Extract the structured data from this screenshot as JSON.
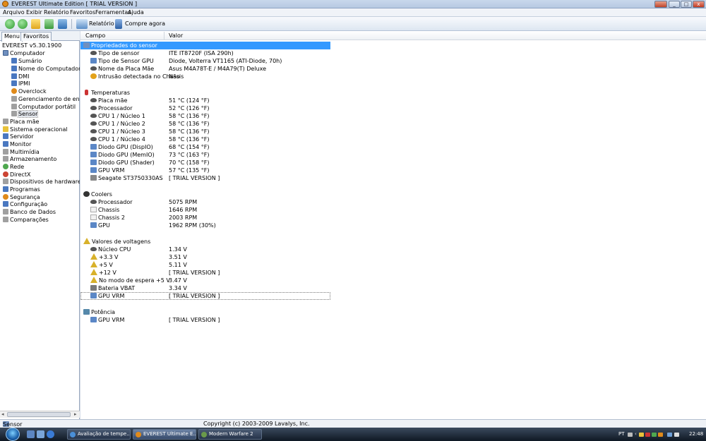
{
  "window": {
    "title": "EVEREST Ultimate Edition  [ TRIAL VERSION ]",
    "controls": [
      "_",
      "□",
      "x"
    ]
  },
  "menubar": [
    "Arquivo",
    "Exibir",
    "Relatório",
    "Favoritos",
    "Ferramentas",
    "Ajuda"
  ],
  "toolbar": {
    "report_label": "Relatório",
    "buy_label": "Compre agora"
  },
  "leftpanel": {
    "tabs": [
      "Menu",
      "Favoritos"
    ],
    "version": "EVEREST v5.30.1900",
    "tree": [
      {
        "label": "Computador",
        "icon": "computer-icon"
      },
      {
        "label": "Sumário",
        "icon": "summary-icon"
      },
      {
        "label": "Nome do Computador",
        "icon": "computer-name-icon"
      },
      {
        "label": "DMI",
        "icon": "dmi-icon"
      },
      {
        "label": "IPMI",
        "icon": "ipmi-icon"
      },
      {
        "label": "Overclock",
        "icon": "overclock-icon"
      },
      {
        "label": "Gerenciamento de energia",
        "icon": "power-management-icon"
      },
      {
        "label": "Computador portátil",
        "icon": "laptop-icon"
      },
      {
        "label": "Sensor",
        "icon": "sensor-icon"
      },
      {
        "label": "Placa mãe",
        "icon": "motherboard-icon"
      },
      {
        "label": "Sistema operacional",
        "icon": "os-icon"
      },
      {
        "label": "Servidor",
        "icon": "server-icon"
      },
      {
        "label": "Monitor",
        "icon": "monitor-icon"
      },
      {
        "label": "Multimídia",
        "icon": "multimedia-icon"
      },
      {
        "label": "Armazenamento",
        "icon": "storage-icon"
      },
      {
        "label": "Rede",
        "icon": "network-icon"
      },
      {
        "label": "DirectX",
        "icon": "directx-icon"
      },
      {
        "label": "Dispositivos de hardware",
        "icon": "hardware-devices-icon"
      },
      {
        "label": "Programas",
        "icon": "programs-icon"
      },
      {
        "label": "Segurança",
        "icon": "security-icon"
      },
      {
        "label": "Configuração",
        "icon": "configuration-icon"
      },
      {
        "label": "Banco de Dados",
        "icon": "database-icon"
      },
      {
        "label": "Comparações",
        "icon": "benchmark-icon"
      }
    ]
  },
  "columns": {
    "field": "Campo",
    "value": "Valor"
  },
  "sections": {
    "sensor_properties": {
      "title": "Propriedades do sensor",
      "rows": [
        {
          "field": "Tipo de sensor",
          "value": "ITE IT8720F  (ISA 290h)"
        },
        {
          "field": "Tipo de Sensor GPU",
          "value": "Diode, Volterra VT1165  (ATI-Diode, 70h)"
        },
        {
          "field": "Nome da Placa Mãe",
          "value": "Asus M4A78T-E / M4A79(T) Deluxe"
        },
        {
          "field": "Intrusão detectada no Chassis",
          "value": "Não"
        }
      ]
    },
    "temperatures": {
      "title": "Temperaturas",
      "rows": [
        {
          "field": "Placa mãe",
          "value": "51 °C  (124 °F)"
        },
        {
          "field": "Processador",
          "value": "52 °C  (126 °F)"
        },
        {
          "field": "CPU 1 / Núcleo 1",
          "value": "58 °C  (136 °F)"
        },
        {
          "field": "CPU 1 / Núcleo 2",
          "value": "58 °C  (136 °F)"
        },
        {
          "field": "CPU 1 / Núcleo 3",
          "value": "58 °C  (136 °F)"
        },
        {
          "field": "CPU 1 / Núcleo 4",
          "value": "58 °C  (136 °F)"
        },
        {
          "field": "Diodo GPU (DispIO)",
          "value": "68 °C  (154 °F)"
        },
        {
          "field": "Diodo GPU (MemIO)",
          "value": "73 °C  (163 °F)"
        },
        {
          "field": "Diodo GPU (Shader)",
          "value": "70 °C  (158 °F)"
        },
        {
          "field": "GPU VRM",
          "value": "57 °C  (135 °F)"
        },
        {
          "field": "Seagate ST3750330AS",
          "value": "[ TRIAL VERSION ]"
        }
      ]
    },
    "coolers": {
      "title": "Coolers",
      "rows": [
        {
          "field": "Processador",
          "value": "5075 RPM"
        },
        {
          "field": "Chassis",
          "value": "1646 RPM"
        },
        {
          "field": "Chassis 2",
          "value": "2003 RPM"
        },
        {
          "field": "GPU",
          "value": "1962 RPM  (30%)"
        }
      ]
    },
    "voltages": {
      "title": "Valores de voltagens",
      "rows": [
        {
          "field": "Núcleo CPU",
          "value": "1.34 V"
        },
        {
          "field": "+3.3 V",
          "value": "3.51 V"
        },
        {
          "field": "+5 V",
          "value": "5.11 V"
        },
        {
          "field": "+12 V",
          "value": "[ TRIAL VERSION ]"
        },
        {
          "field": "No modo de espera +5 V",
          "value": "3.47 V"
        },
        {
          "field": "Bateria VBAT",
          "value": "3.34 V"
        },
        {
          "field": "GPU VRM",
          "value": "[ TRIAL VERSION ]"
        }
      ]
    },
    "power": {
      "title": "Potência",
      "rows": [
        {
          "field": "GPU VRM",
          "value": "[ TRIAL VERSION ]"
        }
      ]
    }
  },
  "statusbar": {
    "left": "Sensor",
    "center": "Copyright (c) 2003-2009 Lavalys, Inc."
  },
  "taskbar": {
    "tasks": [
      "Avaliação de tempe...",
      "EVEREST Ultimate E...",
      "Modern Warfare 2"
    ],
    "tray_lang": "PT",
    "clock": "22:48"
  }
}
